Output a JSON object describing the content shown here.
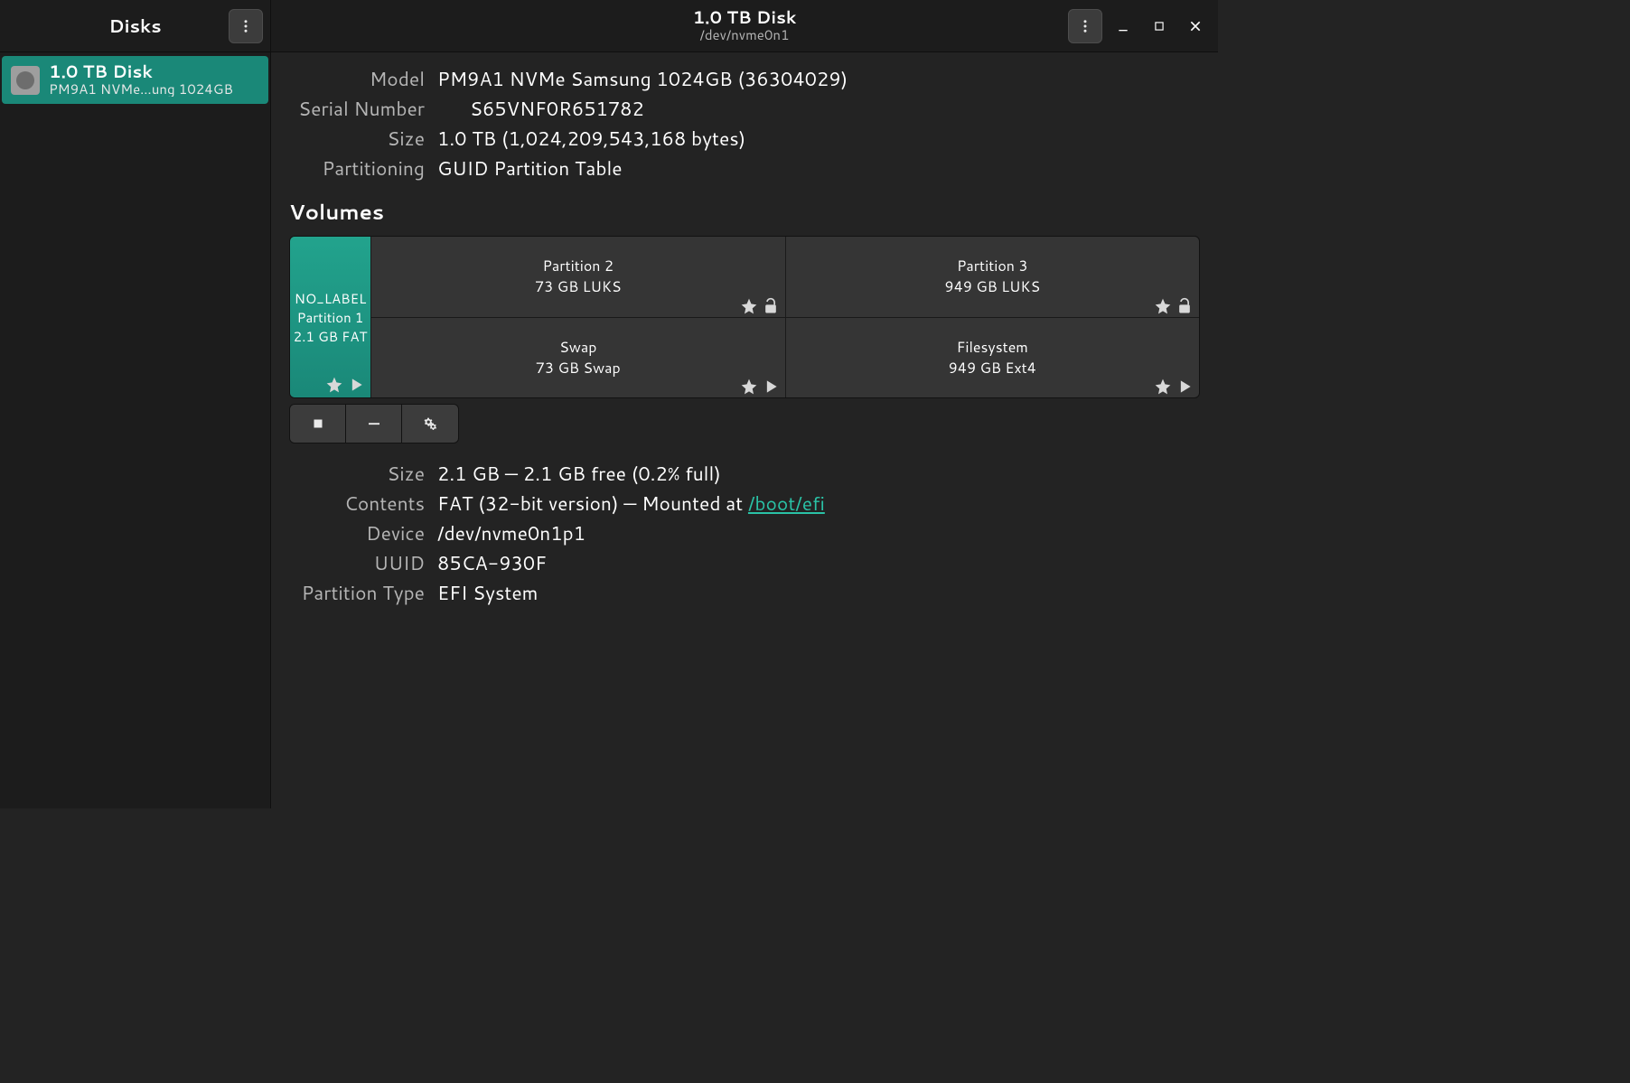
{
  "sidebar": {
    "title": "Disks",
    "items": [
      {
        "title": "1.0 TB Disk",
        "subtitle": "PM9A1 NVMe…ung 1024GB"
      }
    ]
  },
  "header": {
    "title": "1.0 TB Disk",
    "subtitle": "/dev/nvme0n1"
  },
  "disk_info": {
    "model_label": "Model",
    "model_value": "PM9A1 NVMe Samsung 1024GB (36304029)",
    "serial_label": "Serial Number",
    "serial_value": "S65VNF0R651782",
    "size_label": "Size",
    "size_value": "1.0 TB (1,024,209,543,168 bytes)",
    "partitioning_label": "Partitioning",
    "partitioning_value": "GUID Partition Table"
  },
  "volumes_heading": "Volumes",
  "partitions": {
    "p1": {
      "line1": "NO_LABEL",
      "line2": "Partition 1",
      "line3": "2.1 GB FAT"
    },
    "p2_top": {
      "line1": "Partition 2",
      "line2": "73 GB LUKS"
    },
    "p2_bottom": {
      "line1": "Swap",
      "line2": "73 GB Swap"
    },
    "p3_top": {
      "line1": "Partition 3",
      "line2": "949 GB LUKS"
    },
    "p3_bottom": {
      "line1": "Filesystem",
      "line2": "949 GB Ext4"
    }
  },
  "selected": {
    "size_label": "Size",
    "size_value": "2.1 GB — 2.1 GB free (0.2% full)",
    "contents_label": "Contents",
    "contents_prefix": "FAT (32-bit version) — Mounted at ",
    "contents_mount": "/boot/efi",
    "device_label": "Device",
    "device_value": "/dev/nvme0n1p1",
    "uuid_label": "UUID",
    "uuid_value": "85CA-930F",
    "ptype_label": "Partition Type",
    "ptype_value": "EFI System"
  }
}
